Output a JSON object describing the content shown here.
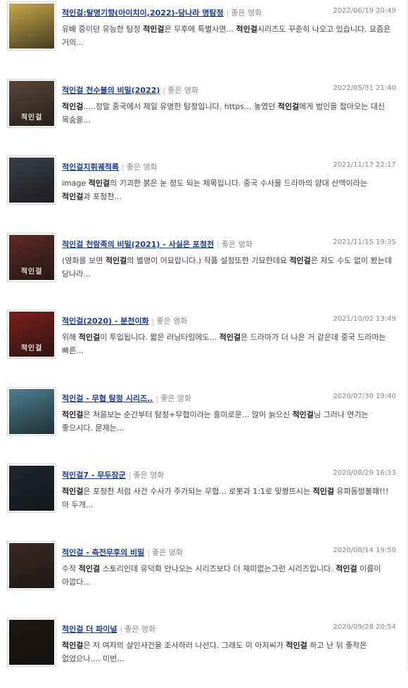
{
  "category_label": "좋은 영화",
  "posts": [
    {
      "title_pre": "",
      "title_kw": "적인걸",
      "title_post": ":탈명기향(아이치이,2022)-당나라 명탐정",
      "date": "2022/06/19 20:49",
      "snippet": [
        [
          "유배 중이던 유능한 탐정 ",
          ""
        ],
        [
          "적인걸",
          "b"
        ],
        [
          "은 무후에 특별사면... ",
          ""
        ],
        [
          "적인걸",
          "b"
        ],
        [
          "시리즈도 꾸준히 나오고 있습니다. 요즘은 거의...",
          ""
        ]
      ],
      "thumb_color": "#c9a84a",
      "thumb_caption": ""
    },
    {
      "title_pre": "",
      "title_kw": "적인걸",
      "title_post": " 천수불의 비밀(2022)",
      "date": "2022/05/31 21:40",
      "snippet": [
        [
          "적인걸",
          "b"
        ],
        [
          ".....정말 중국에서 제일 유명한 탐정입니다. https... 놓였던 ",
          ""
        ],
        [
          "적인걸",
          "b"
        ],
        [
          "에게 범인을 잡아오는 대신 목숨을...",
          ""
        ]
      ],
      "thumb_color": "#5a4638",
      "thumb_caption": "적인걸"
    },
    {
      "title_pre": "",
      "title_kw": "적인걸",
      "title_post": "지휘궤적록",
      "date": "2021/11/17 22:17",
      "snippet": [
        [
          "image ",
          ""
        ],
        [
          "적인걸",
          "b"
        ],
        [
          "의 기괴한 붉은 눈 정도 되는 제목입니다. 중국 수사물 드라마의 양대 산맥이라는 ",
          ""
        ],
        [
          "적인걸",
          "b"
        ],
        [
          "과 포청천...",
          ""
        ]
      ],
      "thumb_color": "#3b3e48",
      "thumb_caption": ""
    },
    {
      "title_pre": "",
      "title_kw": "적인걸",
      "title_post": " 천랑족의 비밀(2021) - 사실은 포청천",
      "date": "2021/11/15 19:35",
      "snippet": [
        [
          "(영화를 보면 ",
          ""
        ],
        [
          "적인걸",
          "b"
        ],
        [
          "의 별명이 어묘랍니다.) 작품 설정또한 기묘한데요 ",
          ""
        ],
        [
          "적인걸",
          "b"
        ],
        [
          "은 저도 수도 없이 봤는데 당나라...",
          ""
        ]
      ],
      "thumb_color": "#5c2b22",
      "thumb_caption": "적인걸"
    },
    {
      "title_pre": "",
      "title_kw": "적인걸",
      "title_post": "(2020) - 분천이화",
      "date": "2021/10/02 13:49",
      "snippet": [
        [
          "위해 ",
          ""
        ],
        [
          "적인걸",
          "b"
        ],
        [
          "이 투입됩니다. 짧은 러닝타임에도... ",
          ""
        ],
        [
          "적인걸",
          "b"
        ],
        [
          "은 드라마가 더 나은 거 같은데 중국 드라마는 빠른...",
          ""
        ]
      ],
      "thumb_color": "#7a1f1a",
      "thumb_caption": "적인걸"
    },
    {
      "title_pre": "",
      "title_kw": "적인걸",
      "title_post": " - 무협 탐정 시리즈..",
      "date": "2020/07/30 19:40",
      "snippet": [
        [
          "적인걸",
          "b"
        ],
        [
          "은 처음보는 순간부터 탐정+무협이라는 흥미로운... 많이 늙으신 ",
          ""
        ],
        [
          "적인걸",
          "b"
        ],
        [
          "님 그러나 연기는 좋으시다. 문제는...",
          ""
        ]
      ],
      "thumb_color": "#4d7f93",
      "thumb_caption": ""
    },
    {
      "title_pre": "",
      "title_kw": "적인걸",
      "title_post": "7 - 무두장군",
      "date": "2020/08/29 16:33",
      "snippet": [
        [
          "적인걸",
          "b"
        ],
        [
          "은 포청천 처럼 사건 수사가 주가되는 무협... 로봇과 1:1로 맞짱뜨시는 ",
          ""
        ],
        [
          "적인걸",
          "b"
        ],
        [
          " 유파동방불패!!! 아 두개...",
          ""
        ]
      ],
      "thumb_color": "#1e2630",
      "thumb_caption": ""
    },
    {
      "title_pre": "",
      "title_kw": "적인걸",
      "title_post": " - 측전무후의 비밀",
      "date": "2020/08/14 19:50",
      "snippet": [
        [
          "수작 ",
          ""
        ],
        [
          "적인걸",
          "b"
        ],
        [
          " 스토리인데 유덕화 안나오는 시리즈보다 더 재미없는그런 시리즈입니다. ",
          ""
        ],
        [
          "적인걸",
          "b"
        ],
        [
          " 이름이 아깝다...",
          ""
        ]
      ],
      "thumb_color": "#3a2a24",
      "thumb_caption": ""
    },
    {
      "title_pre": "",
      "title_kw": "적인걸",
      "title_post": " 더 파이널",
      "date": "2020/09/28 20:54",
      "snippet": [
        [
          "적인걸",
          "b"
        ],
        [
          "은 저 여자의 살인사건을 조사하러 나선다. 그래도 이 아저씨가 ",
          ""
        ],
        [
          "적인걸",
          "b"
        ],
        [
          " 하고 난 뒤 좋작은 없었으나.... 이번...",
          ""
        ]
      ],
      "thumb_color": "#1c1812",
      "thumb_caption": ""
    }
  ]
}
